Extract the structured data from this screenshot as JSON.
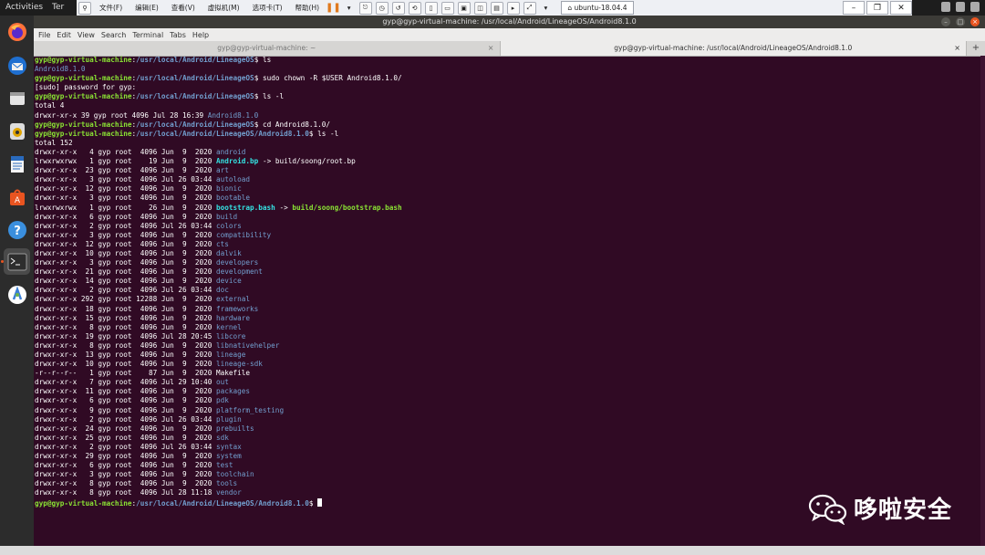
{
  "topbar": {
    "activities": "Activities",
    "app_hint": "Ter"
  },
  "vmware": {
    "menus": [
      "文件(F)",
      "编辑(E)",
      "查看(V)",
      "虚拟机(M)",
      "选项卡(T)",
      "帮助(H)"
    ],
    "vm_tab": "ubuntu-18.04.4"
  },
  "window": {
    "title": "gyp@gyp-virtual-machine: /usr/local/Android/LineageOS/Android8.1.0",
    "menu": [
      "File",
      "Edit",
      "View",
      "Search",
      "Terminal",
      "Tabs",
      "Help"
    ],
    "tabs": [
      {
        "label": "gyp@gyp-virtual-machine: ~"
      },
      {
        "label": "gyp@gyp-virtual-machine: /usr/local/Android/LineageOS/Android8.1.0"
      }
    ],
    "new_tab": "+"
  },
  "dock": {
    "icons": [
      "firefox-icon",
      "thunderbird-icon",
      "files-icon",
      "rhythmbox-icon",
      "libreoffice-writer-icon",
      "software-center-icon",
      "help-icon",
      "terminal-icon",
      "android-studio-icon"
    ]
  },
  "terminal": {
    "prompt_user": "gyp@gyp-virtual-machine",
    "lines": [
      {
        "seg": [
          [
            "g",
            "gyp@gyp-virtual-machine"
          ],
          [
            "w",
            ":"
          ],
          [
            "b",
            "/usr/local/Android/LineageOS"
          ],
          [
            "w",
            "$ ls"
          ]
        ]
      },
      {
        "seg": [
          [
            "d",
            "Android8.1.0"
          ]
        ]
      },
      {
        "seg": [
          [
            "g",
            "gyp@gyp-virtual-machine"
          ],
          [
            "w",
            ":"
          ],
          [
            "b",
            "/usr/local/Android/LineageOS"
          ],
          [
            "w",
            "$ sudo chown -R $USER Android8.1.0/"
          ]
        ]
      },
      {
        "seg": [
          [
            "w",
            "[sudo] password for gyp: "
          ]
        ]
      },
      {
        "seg": [
          [
            "g",
            "gyp@gyp-virtual-machine"
          ],
          [
            "w",
            ":"
          ],
          [
            "b",
            "/usr/local/Android/LineageOS"
          ],
          [
            "w",
            "$ ls -l"
          ]
        ]
      },
      {
        "seg": [
          [
            "w",
            "total 4"
          ]
        ]
      },
      {
        "seg": [
          [
            "w",
            "drwxr-xr-x 39 gyp root 4096 Jul 28 16:39 "
          ],
          [
            "d",
            "Android8.1.0"
          ]
        ]
      },
      {
        "seg": [
          [
            "g",
            "gyp@gyp-virtual-machine"
          ],
          [
            "w",
            ":"
          ],
          [
            "b",
            "/usr/local/Android/LineageOS"
          ],
          [
            "w",
            "$ cd Android8.1.0/"
          ]
        ]
      },
      {
        "seg": [
          [
            "g",
            "gyp@gyp-virtual-machine"
          ],
          [
            "w",
            ":"
          ],
          [
            "b",
            "/usr/local/Android/LineageOS/Android8.1.0"
          ],
          [
            "w",
            "$ ls -l"
          ]
        ]
      },
      {
        "seg": [
          [
            "w",
            "total 152"
          ]
        ]
      },
      {
        "seg": [
          [
            "w",
            "drwxr-xr-x   4 gyp root  4096 Jun  9  2020 "
          ],
          [
            "d",
            "android"
          ]
        ]
      },
      {
        "seg": [
          [
            "w",
            "lrwxrwxrwx   1 gyp root    19 Jun  9  2020 "
          ],
          [
            "c",
            "Android.bp"
          ],
          [
            "w",
            " -> build/soong/root.bp"
          ]
        ]
      },
      {
        "seg": [
          [
            "w",
            "drwxr-xr-x  23 gyp root  4096 Jun  9  2020 "
          ],
          [
            "d",
            "art"
          ]
        ]
      },
      {
        "seg": [
          [
            "w",
            "drwxr-xr-x   3 gyp root  4096 Jul 26 03:44 "
          ],
          [
            "d",
            "autoload"
          ]
        ]
      },
      {
        "seg": [
          [
            "w",
            "drwxr-xr-x  12 gyp root  4096 Jun  9  2020 "
          ],
          [
            "d",
            "bionic"
          ]
        ]
      },
      {
        "seg": [
          [
            "w",
            "drwxr-xr-x   3 gyp root  4096 Jun  9  2020 "
          ],
          [
            "d",
            "bootable"
          ]
        ]
      },
      {
        "seg": [
          [
            "w",
            "lrwxrwxrwx   1 gyp root    26 Jun  9  2020 "
          ],
          [
            "c",
            "bootstrap.bash"
          ],
          [
            "w",
            " -> "
          ],
          [
            "gy",
            "build/soong/bootstrap.bash"
          ]
        ]
      },
      {
        "seg": [
          [
            "w",
            "drwxr-xr-x   6 gyp root  4096 Jun  9  2020 "
          ],
          [
            "d",
            "build"
          ]
        ]
      },
      {
        "seg": [
          [
            "w",
            "drwxr-xr-x   2 gyp root  4096 Jul 26 03:44 "
          ],
          [
            "d",
            "colors"
          ]
        ]
      },
      {
        "seg": [
          [
            "w",
            "drwxr-xr-x   3 gyp root  4096 Jun  9  2020 "
          ],
          [
            "d",
            "compatibility"
          ]
        ]
      },
      {
        "seg": [
          [
            "w",
            "drwxr-xr-x  12 gyp root  4096 Jun  9  2020 "
          ],
          [
            "d",
            "cts"
          ]
        ]
      },
      {
        "seg": [
          [
            "w",
            "drwxr-xr-x  10 gyp root  4096 Jun  9  2020 "
          ],
          [
            "d",
            "dalvik"
          ]
        ]
      },
      {
        "seg": [
          [
            "w",
            "drwxr-xr-x   3 gyp root  4096 Jun  9  2020 "
          ],
          [
            "d",
            "developers"
          ]
        ]
      },
      {
        "seg": [
          [
            "w",
            "drwxr-xr-x  21 gyp root  4096 Jun  9  2020 "
          ],
          [
            "d",
            "development"
          ]
        ]
      },
      {
        "seg": [
          [
            "w",
            "drwxr-xr-x  14 gyp root  4096 Jun  9  2020 "
          ],
          [
            "d",
            "device"
          ]
        ]
      },
      {
        "seg": [
          [
            "w",
            "drwxr-xr-x   2 gyp root  4096 Jul 26 03:44 "
          ],
          [
            "d",
            "doc"
          ]
        ]
      },
      {
        "seg": [
          [
            "w",
            "drwxr-xr-x 292 gyp root 12288 Jun  9  2020 "
          ],
          [
            "d",
            "external"
          ]
        ]
      },
      {
        "seg": [
          [
            "w",
            "drwxr-xr-x  18 gyp root  4096 Jun  9  2020 "
          ],
          [
            "d",
            "frameworks"
          ]
        ]
      },
      {
        "seg": [
          [
            "w",
            "drwxr-xr-x  15 gyp root  4096 Jun  9  2020 "
          ],
          [
            "d",
            "hardware"
          ]
        ]
      },
      {
        "seg": [
          [
            "w",
            "drwxr-xr-x   8 gyp root  4096 Jun  9  2020 "
          ],
          [
            "d",
            "kernel"
          ]
        ]
      },
      {
        "seg": [
          [
            "w",
            "drwxr-xr-x  19 gyp root  4096 Jul 28 20:45 "
          ],
          [
            "d",
            "libcore"
          ]
        ]
      },
      {
        "seg": [
          [
            "w",
            "drwxr-xr-x   8 gyp root  4096 Jun  9  2020 "
          ],
          [
            "d",
            "libnativehelper"
          ]
        ]
      },
      {
        "seg": [
          [
            "w",
            "drwxr-xr-x  13 gyp root  4096 Jun  9  2020 "
          ],
          [
            "d",
            "lineage"
          ]
        ]
      },
      {
        "seg": [
          [
            "w",
            "drwxr-xr-x  10 gyp root  4096 Jun  9  2020 "
          ],
          [
            "d",
            "lineage-sdk"
          ]
        ]
      },
      {
        "seg": [
          [
            "w",
            "-r--r--r--   1 gyp root    87 Jun  9  2020 Makefile"
          ]
        ]
      },
      {
        "seg": [
          [
            "w",
            "drwxr-xr-x   7 gyp root  4096 Jul 29 10:40 "
          ],
          [
            "d",
            "out"
          ]
        ]
      },
      {
        "seg": [
          [
            "w",
            "drwxr-xr-x  11 gyp root  4096 Jun  9  2020 "
          ],
          [
            "d",
            "packages"
          ]
        ]
      },
      {
        "seg": [
          [
            "w",
            "drwxr-xr-x   6 gyp root  4096 Jun  9  2020 "
          ],
          [
            "d",
            "pdk"
          ]
        ]
      },
      {
        "seg": [
          [
            "w",
            "drwxr-xr-x   9 gyp root  4096 Jun  9  2020 "
          ],
          [
            "d",
            "platform_testing"
          ]
        ]
      },
      {
        "seg": [
          [
            "w",
            "drwxr-xr-x   2 gyp root  4096 Jul 26 03:44 "
          ],
          [
            "d",
            "plugin"
          ]
        ]
      },
      {
        "seg": [
          [
            "w",
            "drwxr-xr-x  24 gyp root  4096 Jun  9  2020 "
          ],
          [
            "d",
            "prebuilts"
          ]
        ]
      },
      {
        "seg": [
          [
            "w",
            "drwxr-xr-x  25 gyp root  4096 Jun  9  2020 "
          ],
          [
            "d",
            "sdk"
          ]
        ]
      },
      {
        "seg": [
          [
            "w",
            "drwxr-xr-x   2 gyp root  4096 Jul 26 03:44 "
          ],
          [
            "d",
            "syntax"
          ]
        ]
      },
      {
        "seg": [
          [
            "w",
            "drwxr-xr-x  29 gyp root  4096 Jun  9  2020 "
          ],
          [
            "d",
            "system"
          ]
        ]
      },
      {
        "seg": [
          [
            "w",
            "drwxr-xr-x   6 gyp root  4096 Jun  9  2020 "
          ],
          [
            "d",
            "test"
          ]
        ]
      },
      {
        "seg": [
          [
            "w",
            "drwxr-xr-x   3 gyp root  4096 Jun  9  2020 "
          ],
          [
            "d",
            "toolchain"
          ]
        ]
      },
      {
        "seg": [
          [
            "w",
            "drwxr-xr-x   8 gyp root  4096 Jun  9  2020 "
          ],
          [
            "d",
            "tools"
          ]
        ]
      },
      {
        "seg": [
          [
            "w",
            "drwxr-xr-x   8 gyp root  4096 Jul 28 11:18 "
          ],
          [
            "d",
            "vendor"
          ]
        ]
      },
      {
        "seg": [
          [
            "g",
            "gyp@gyp-virtual-machine"
          ],
          [
            "w",
            ":"
          ],
          [
            "b",
            "/usr/local/Android/LineageOS/Android8.1.0"
          ],
          [
            "w",
            "$ "
          ]
        ]
      }
    ]
  },
  "watermark": {
    "text": "哆啦安全"
  },
  "colors": {
    "terminal_bg": "#300a24",
    "prompt_green": "#8ae234",
    "path_blue": "#729fcf",
    "link_cyan": "#34e2e2",
    "accent_orange": "#e95420"
  }
}
